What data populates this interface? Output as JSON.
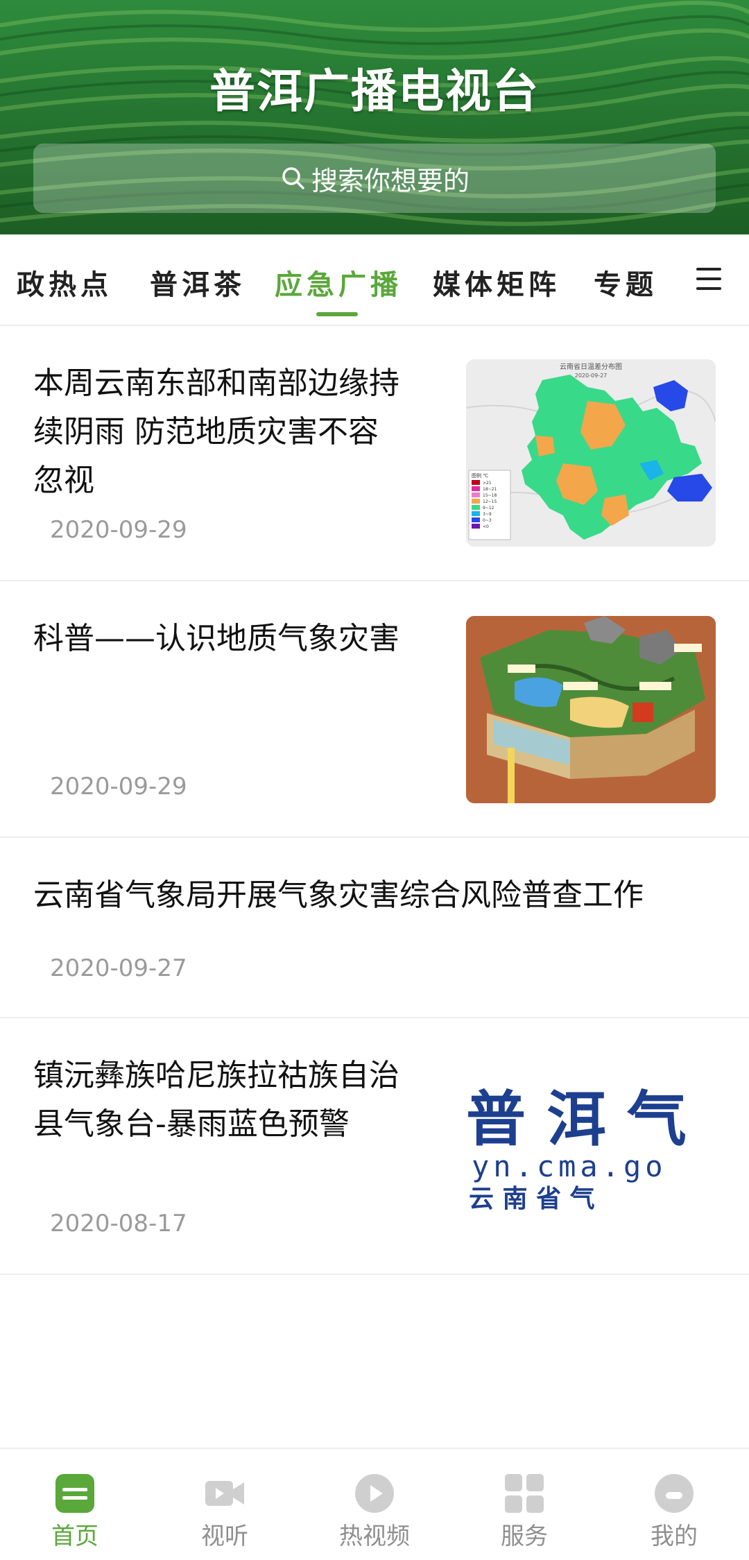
{
  "header": {
    "title": "普洱广播电视台",
    "search_placeholder": "搜索你想要的"
  },
  "tabs": [
    {
      "label": "政热点",
      "active": false
    },
    {
      "label": "普洱茶",
      "active": false
    },
    {
      "label": "应急广播",
      "active": true
    },
    {
      "label": "媒体矩阵",
      "active": false
    },
    {
      "label": "专题",
      "active": false
    }
  ],
  "articles": [
    {
      "headline_lines": [
        "本周云南东部和南部边缘持",
        "续阴雨 防范地质灾害不容",
        "忽视"
      ],
      "date": "2020-09-29",
      "thumb": "yunnan-temperature-map",
      "thumb_texts": {
        "title": "云南省日温差分布图",
        "subtitle": "2020-09-27",
        "legend_title": "图例 ℃",
        "legend": [
          ">21",
          "18~21",
          "15~18",
          "12~15",
          "9~12",
          "3~9",
          "0~3",
          "<0"
        ]
      }
    },
    {
      "headline_lines": [
        "科普——认识地质气象灾害"
      ],
      "date": "2020-09-29",
      "thumb": "geology-disaster-illustration"
    },
    {
      "headline_lines": [
        "云南省气象局开展气象灾害综合风险普查工作"
      ],
      "date": "2020-09-27",
      "thumb": null
    },
    {
      "headline_lines": [
        "镇沅彝族哈尼族拉祜族自治",
        "县气象台-暴雨蓝色预警"
      ],
      "date": "2020-08-17",
      "thumb": "puer-weather-logo",
      "thumb_texts": {
        "line1": "普 洱 气",
        "line2": "yn.cma.go",
        "line3": "云 南 省 气"
      }
    }
  ],
  "bottom_nav": [
    {
      "label": "首页",
      "icon": "home-icon",
      "active": true
    },
    {
      "label": "视听",
      "icon": "video-camera-icon",
      "active": false
    },
    {
      "label": "热视频",
      "icon": "play-circle-icon",
      "active": false
    },
    {
      "label": "服务",
      "icon": "grid-icon",
      "active": false
    },
    {
      "label": "我的",
      "icon": "user-icon",
      "active": false
    }
  ],
  "colors": {
    "accent": "#5aa83a",
    "inactive": "#8f8f8f",
    "date": "#9a9a9a",
    "divider": "#eeeeee"
  }
}
